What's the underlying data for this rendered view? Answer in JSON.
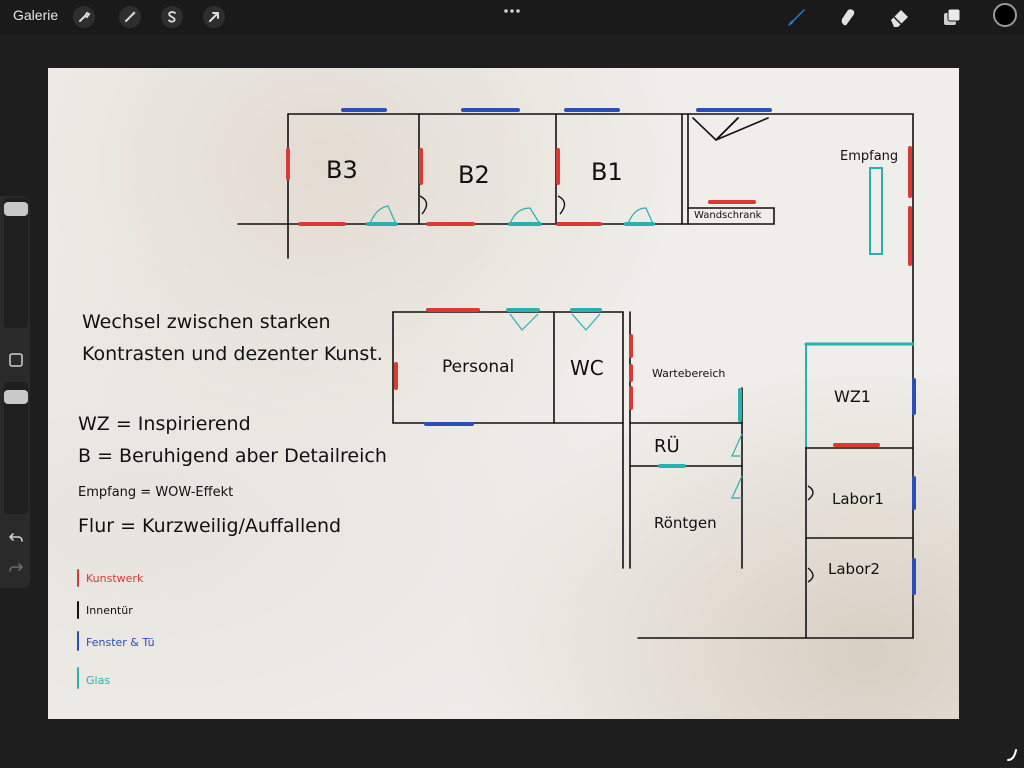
{
  "topbar": {
    "gallery_label": "Galerie",
    "left_icons": [
      "wrench-icon",
      "magic-wand-icon",
      "selection-s-icon",
      "arrow-transform-icon"
    ],
    "right_icons": [
      "brush-icon",
      "smudge-icon",
      "eraser-icon",
      "layers-icon"
    ],
    "color_well": "#000000",
    "brush_active_color": "#1f7fe0"
  },
  "sidebar": {
    "buttons": [
      "square-modify-icon",
      "undo-icon",
      "redo-icon"
    ]
  },
  "drawing": {
    "rooms": {
      "b3": "B3",
      "b2": "B2",
      "b1": "B1",
      "wandschrank": "Wandschrank",
      "empfang": "Empfang",
      "personal": "Personal",
      "wc": "WC",
      "wartebereich": "Wartebereich",
      "roentgen_small": "RÜ",
      "roentgen": "Röntgen",
      "wz1": "WZ1",
      "labor1": "Labor1",
      "labor2": "Labor2"
    },
    "notes": {
      "line1": "Wechsel zwischen starken",
      "line2": "Kontrasten und dezenter Kunst.",
      "wz": "WZ   = Inspirierend",
      "b": "B     = Beruhigend aber Detailreich",
      "empfang": "Empfang  = WOW-Effekt",
      "flur": "Flur   = Kurzweilig/Auffallend"
    },
    "legend": [
      {
        "label": "Kunstwerk",
        "color": "#d93a34"
      },
      {
        "label": "Innentür",
        "color": "#111111"
      },
      {
        "label": "Fenster & Tü",
        "color": "#2a4fb8"
      },
      {
        "label": "Glas",
        "color": "#2ab0b0"
      }
    ],
    "colors": {
      "art": "#d93a34",
      "door": "#111111",
      "window": "#2a4fb8",
      "glass": "#2ab0b0"
    }
  }
}
